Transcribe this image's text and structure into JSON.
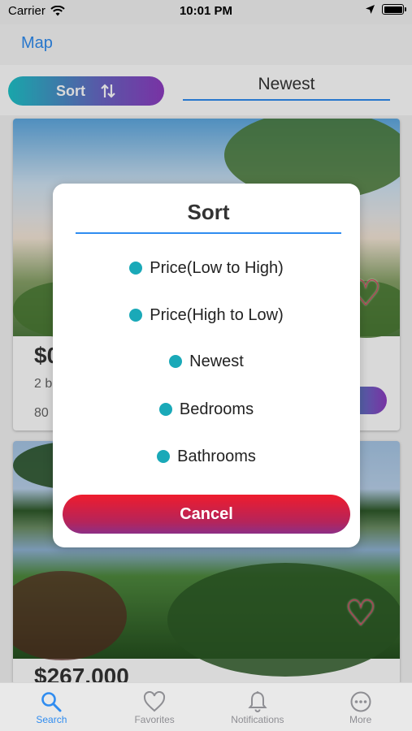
{
  "status_bar": {
    "carrier": "Carrier",
    "time": "10:01 PM"
  },
  "nav": {
    "map_label": "Map"
  },
  "sort_bar": {
    "sort_label": "Sort",
    "current_sort": "Newest"
  },
  "listings": [
    {
      "price_partial": "$0",
      "beds_partial": "2 b",
      "size_partial": "80"
    },
    {
      "price": "$267,000"
    }
  ],
  "sort_modal": {
    "title": "Sort",
    "options": [
      "Price(Low to High)",
      "Price(High to Low)",
      "Newest",
      "Bedrooms",
      "Bathrooms"
    ],
    "cancel_label": "Cancel"
  },
  "tab_bar": {
    "tabs": [
      {
        "label": "Search",
        "icon": "search-icon",
        "active": true
      },
      {
        "label": "Favorites",
        "icon": "heart-icon",
        "active": false
      },
      {
        "label": "Notifications",
        "icon": "bell-icon",
        "active": false
      },
      {
        "label": "More",
        "icon": "more-icon",
        "active": false
      }
    ]
  },
  "colors": {
    "accent": "#2f8cf0",
    "dot": "#1aa9b8",
    "cancel_start": "#ef1c2d",
    "cancel_end": "#8d2f86",
    "sort_start": "#1ec3c8",
    "sort_end": "#8e3cc1"
  }
}
